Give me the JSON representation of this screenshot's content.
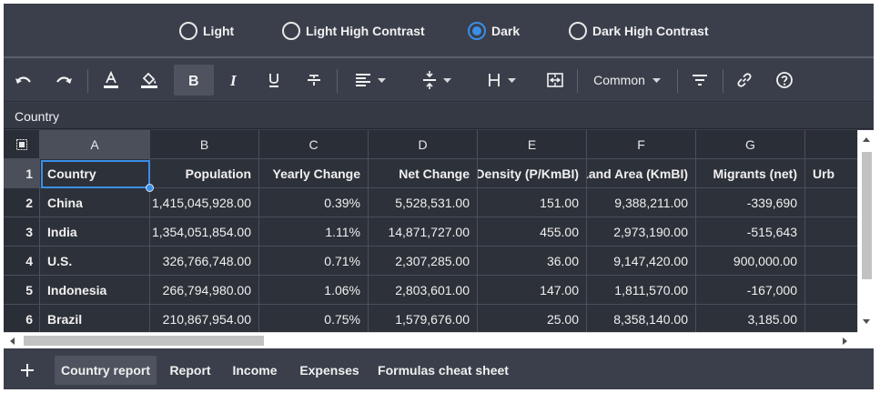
{
  "themes": [
    {
      "label": "Light",
      "checked": false
    },
    {
      "label": "Light High Contrast",
      "checked": false
    },
    {
      "label": "Dark",
      "checked": true
    },
    {
      "label": "Dark High Contrast",
      "checked": false
    }
  ],
  "toolbar": {
    "format_select": "Common",
    "icons": [
      "undo-icon",
      "redo-icon",
      "text-color-icon",
      "fill-color-icon",
      "bold-icon",
      "italic-icon",
      "underline-icon",
      "strikethrough-icon",
      "align-left-icon",
      "vertical-align-icon",
      "row-height-icon",
      "merge-cells-icon",
      "filter-icon",
      "link-icon",
      "help-icon"
    ]
  },
  "formula_bar": {
    "value": "Country"
  },
  "grid": {
    "columns": [
      "A",
      "B",
      "C",
      "D",
      "E",
      "F",
      "G"
    ],
    "rows": [
      [
        "1",
        "Country",
        "Population",
        "Yearly Change",
        "Net Change",
        "Density (P/KmBI)",
        "Land Area (KmBI)",
        "Migrants (net)",
        "Urb"
      ],
      [
        "2",
        "China",
        "1,415,045,928.00",
        "0.39%",
        "5,528,531.00",
        "151.00",
        "9,388,211.00",
        "-339,690",
        ""
      ],
      [
        "3",
        "India",
        "1,354,051,854.00",
        "1.11%",
        "14,871,727.00",
        "455.00",
        "2,973,190.00",
        "-515,643",
        ""
      ],
      [
        "4",
        "U.S.",
        "326,766,748.00",
        "0.71%",
        "2,307,285.00",
        "36.00",
        "9,147,420.00",
        "900,000.00",
        ""
      ],
      [
        "5",
        "Indonesia",
        "266,794,980.00",
        "1.06%",
        "2,803,601.00",
        "147.00",
        "1,811,570.00",
        "-167,000",
        ""
      ],
      [
        "6",
        "Brazil",
        "210,867,954.00",
        "0.75%",
        "1,579,676.00",
        "25.00",
        "8,358,140.00",
        "3,185.00",
        ""
      ]
    ],
    "selected_cell": "A1"
  },
  "sheets": [
    {
      "label": "Country report",
      "active": true
    },
    {
      "label": "Report",
      "active": false
    },
    {
      "label": "Income",
      "active": false
    },
    {
      "label": "Expenses",
      "active": false
    },
    {
      "label": "Formulas cheat sheet",
      "active": false
    }
  ],
  "colors": {
    "accent": "#3b8ee6",
    "background": "#3a3f4b",
    "grid": "#2d3139"
  }
}
